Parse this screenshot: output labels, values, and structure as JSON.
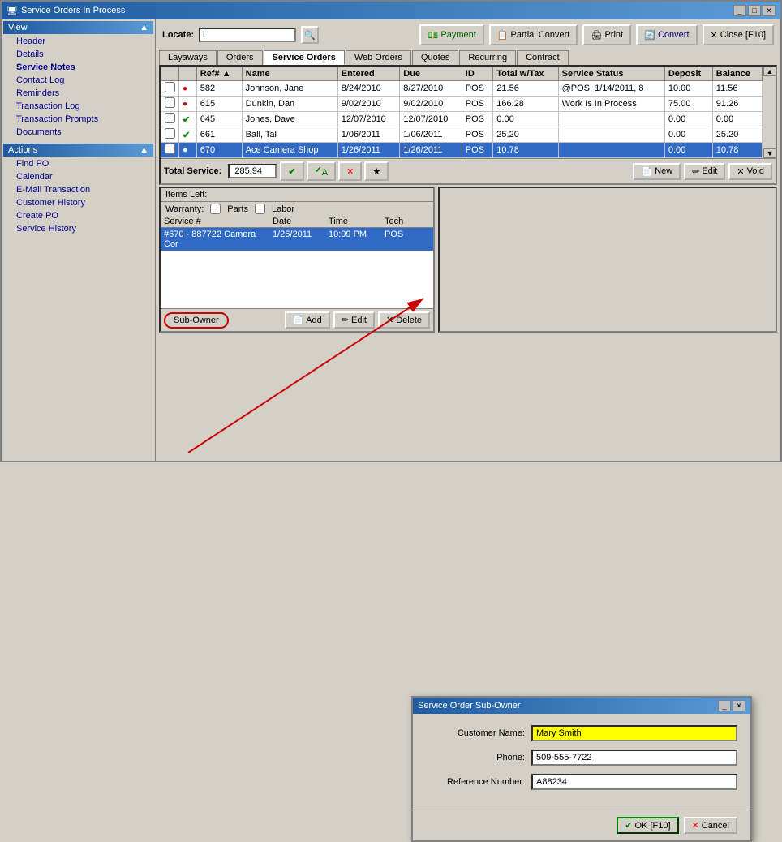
{
  "window": {
    "title": "Service Orders In Process",
    "title_icon": "📋"
  },
  "toolbar": {
    "locate_label": "Locate:",
    "locate_value": "i",
    "locate_placeholder": "",
    "payment_label": "Payment",
    "partial_convert_label": "Partial Convert",
    "print_label": "Print",
    "convert_label": "Convert",
    "close_label": "Close [F10]"
  },
  "tabs": {
    "items": [
      "Layaways",
      "Orders",
      "Service Orders",
      "Web Orders",
      "Quotes",
      "Recurring",
      "Contract"
    ],
    "active": 2
  },
  "table": {
    "columns": [
      "",
      "",
      "Ref#",
      "Name",
      "Entered",
      "Due",
      "ID",
      "Total w/Tax",
      "Service Status",
      "Deposit",
      "Balance"
    ],
    "rows": [
      {
        "ref": "582",
        "name": "Johnson, Jane",
        "entered": "8/24/2010",
        "due": "8/27/2010",
        "id": "POS",
        "total": "21.56",
        "status": "@POS, 1/14/2011, 8",
        "deposit": "10.00",
        "balance": "11.56",
        "checked": false,
        "icon": "red"
      },
      {
        "ref": "615",
        "name": "Dunkin, Dan",
        "entered": "9/02/2010",
        "due": "9/02/2010",
        "id": "POS",
        "total": "166.28",
        "status": "Work Is In Process",
        "deposit": "75.00",
        "balance": "91.26",
        "checked": false,
        "icon": "red"
      },
      {
        "ref": "645",
        "name": "Jones, Dave",
        "entered": "12/07/2010",
        "due": "12/07/2010",
        "id": "POS",
        "total": "0.00",
        "status": "",
        "deposit": "0.00",
        "balance": "0.00",
        "checked": false,
        "icon": "green"
      },
      {
        "ref": "661",
        "name": "Ball, Tal",
        "entered": "1/06/2011",
        "due": "1/06/2011",
        "id": "POS",
        "total": "25.20",
        "status": "",
        "deposit": "0.00",
        "balance": "25.20",
        "checked": false,
        "icon": "green"
      },
      {
        "ref": "670",
        "name": "Ace Camera Shop",
        "entered": "1/26/2011",
        "due": "1/26/2011",
        "id": "POS",
        "total": "10.78",
        "status": "",
        "deposit": "0.00",
        "balance": "10.78",
        "checked": false,
        "icon": "red",
        "selected": true
      }
    ],
    "total_label": "Total Service:",
    "total_value": "285.94",
    "new_label": "New",
    "edit_label": "Edit",
    "void_label": "Void"
  },
  "bottom": {
    "items_left_label": "Items Left:",
    "warranty_label": "Warranty:",
    "parts_label": "Parts",
    "labor_label": "Labor",
    "service_cols": [
      "Service #",
      "Date",
      "Time",
      "Tech"
    ],
    "service_rows": [
      {
        "service_num": "#670 - 887722 Camera Cor",
        "date": "1/26/2011",
        "time": "10:09 PM",
        "tech": "POS"
      }
    ],
    "subowner_label": "Sub-Owner",
    "add_label": "Add",
    "edit_label": "Edit",
    "delete_label": "Delete"
  },
  "sidebar": {
    "view_label": "View",
    "view_items": [
      "Header",
      "Details",
      "Service Notes",
      "Contact Log",
      "Reminders",
      "Transaction Log",
      "Transaction Prompts",
      "Documents"
    ],
    "actions_label": "Actions",
    "actions_items": [
      "Find PO",
      "Calendar",
      "E-Mail Transaction",
      "Customer History",
      "Create PO",
      "Service History"
    ],
    "active_view": "Service Notes"
  },
  "dialog": {
    "title": "Service Order Sub-Owner",
    "customer_name_label": "Customer Name:",
    "customer_name_value": "Mary Smith",
    "phone_label": "Phone:",
    "phone_value": "509-555-7722",
    "ref_label": "Reference Number:",
    "ref_value": "A88234",
    "ok_label": "OK [F10]",
    "cancel_label": "Cancel"
  }
}
